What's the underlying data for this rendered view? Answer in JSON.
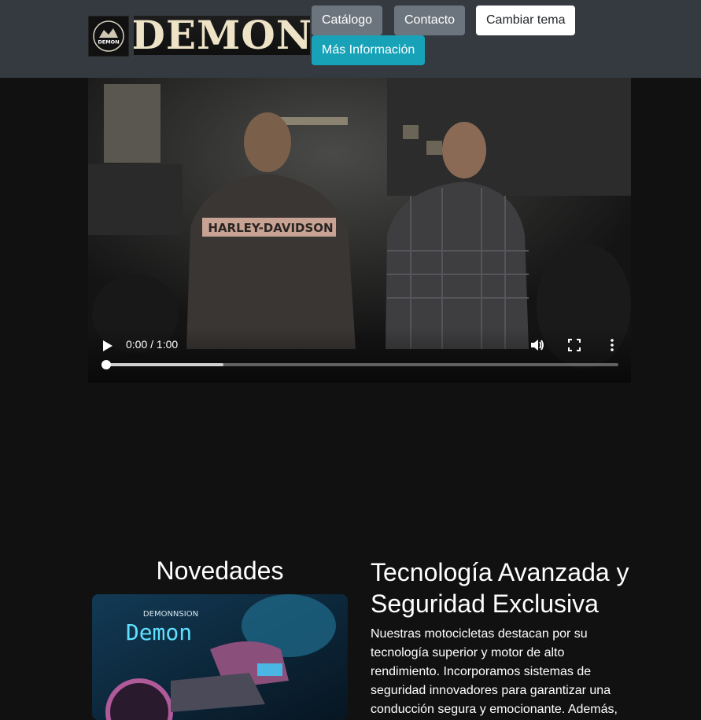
{
  "header": {
    "logo_badge_text": "DEMON",
    "logo_text": "DEMON",
    "nav": {
      "catalogo": "Catálogo",
      "contacto": "Contacto",
      "cambiar_tema": "Cambiar tema",
      "mas_informacion": "Más Información"
    }
  },
  "video": {
    "time_display": "0:00 / 1:00",
    "current_time": "0:00",
    "duration": "1:00",
    "buffered_fraction": 0.23,
    "played_fraction": 0.0,
    "jacket_text": "HARLEY-DAVIDSON",
    "icons": [
      "play-icon",
      "volume-icon",
      "fullscreen-icon",
      "more-options-icon"
    ]
  },
  "novedades": {
    "title": "Novedades",
    "image_text_top": "DEMONNSION",
    "image_text_main": "Demon"
  },
  "tech": {
    "title": "Tecnología Avanzada y Seguridad Exclusiva",
    "body": "Nuestras motocicletas destacan por su tecnología superior y motor de alto rendimiento. Incorporamos sistemas de seguridad innovadores para garantizar una conducción segura y emocionante. Además,"
  },
  "colors": {
    "header_bg": "#343a40",
    "page_bg": "#111111",
    "btn_secondary": "#6c757d",
    "btn_info": "#17a2b8",
    "btn_light": "#ffffff"
  }
}
